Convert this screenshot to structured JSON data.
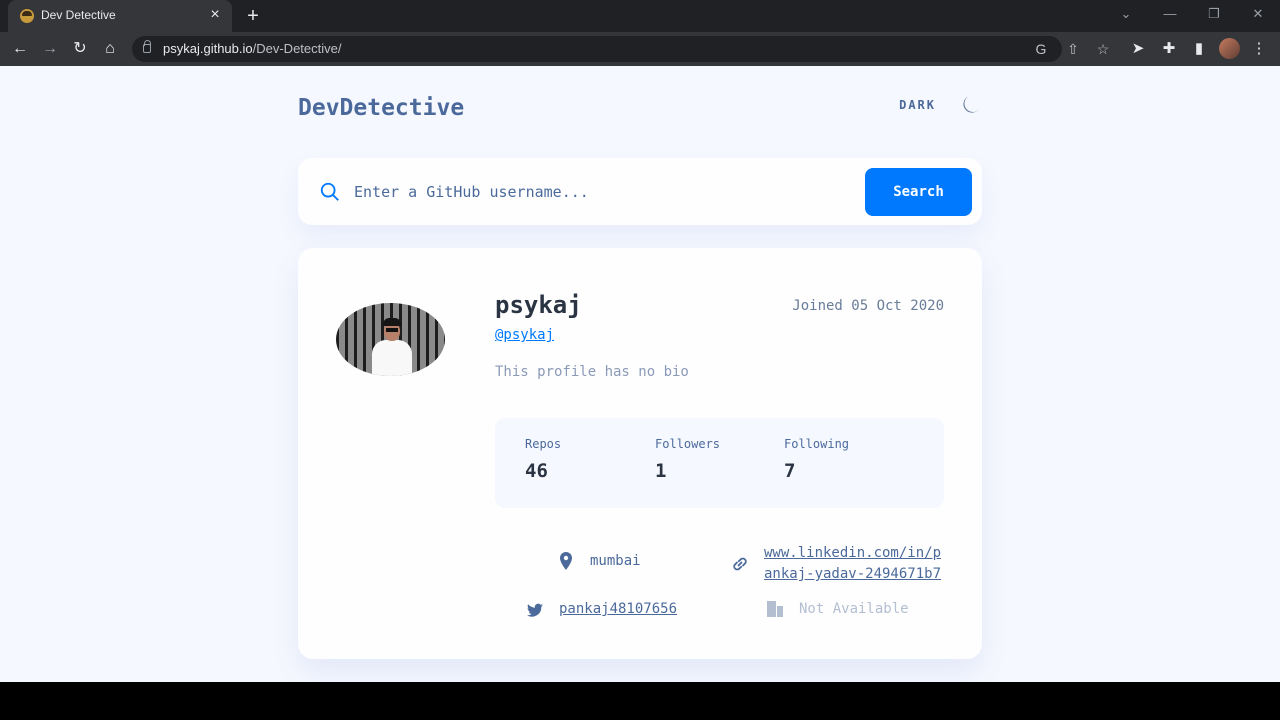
{
  "browser": {
    "tab_title": "Dev Detective",
    "tab_close": "×",
    "new_tab": "+",
    "url_host": "psykaj.github.io",
    "url_path": "/Dev-Detective/",
    "window_controls": {
      "dropdown": "⌄",
      "minimize": "—",
      "restore": "❐",
      "close": "✕"
    }
  },
  "header": {
    "logo": "DevDetective",
    "theme_label": "DARK"
  },
  "search": {
    "placeholder": "Enter a GitHub username...",
    "button_label": "Search"
  },
  "profile": {
    "name": "psykaj",
    "joined": "Joined 05 Oct 2020",
    "handle": "@psykaj",
    "bio": "This profile has no bio",
    "stats": [
      {
        "label": "Repos",
        "value": "46"
      },
      {
        "label": "Followers",
        "value": "1"
      },
      {
        "label": "Following",
        "value": "7"
      }
    ],
    "location": "mumbai",
    "website": "www.linkedin.com/in/pankaj-yadav-2494671b7",
    "twitter": "pankaj48107656",
    "company": "Not Available"
  },
  "colors": {
    "accent": "#0079ff",
    "background": "#f6f8ff",
    "text_primary": "#2b3442",
    "text_secondary": "#4b6a9b"
  }
}
